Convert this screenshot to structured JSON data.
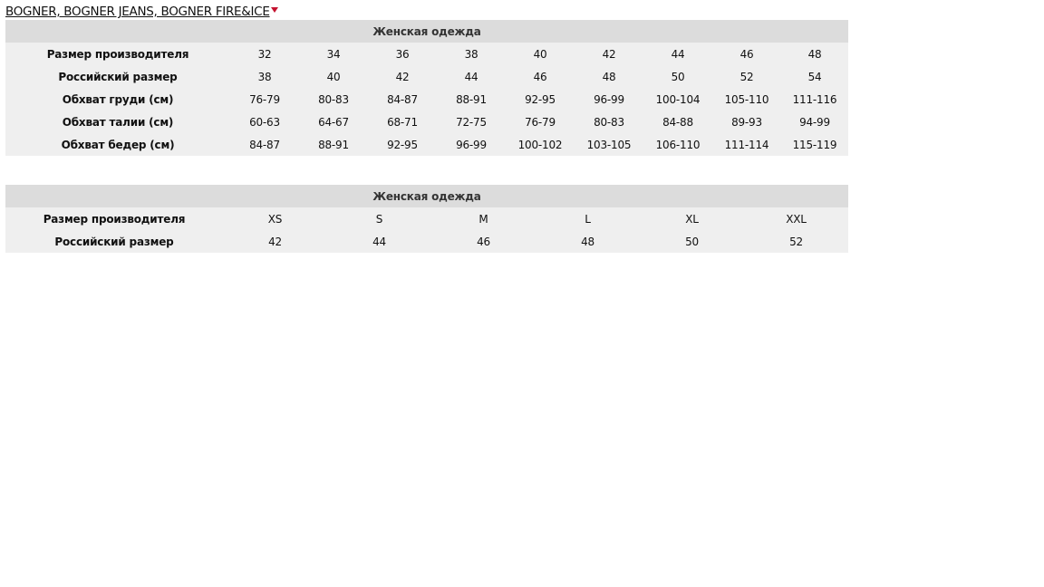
{
  "brand": {
    "label": "BOGNER, BOGNER JEANS, BOGNER FIRE&ICE",
    "arrow_color": "#c4122f"
  },
  "tables": [
    {
      "title": "Женская одежда",
      "rows": [
        {
          "label": "Размер производителя",
          "cells": [
            "32",
            "34",
            "36",
            "38",
            "40",
            "42",
            "44",
            "46",
            "48"
          ]
        },
        {
          "label": "Российский размер",
          "cells": [
            "38",
            "40",
            "42",
            "44",
            "46",
            "48",
            "50",
            "52",
            "54"
          ]
        },
        {
          "label": "Обхват груди (см)",
          "cells": [
            "76-79",
            "80-83",
            "84-87",
            "88-91",
            "92-95",
            "96-99",
            "100-104",
            "105-110",
            "111-116"
          ]
        },
        {
          "label": "Обхват талии (см)",
          "cells": [
            "60-63",
            "64-67",
            "68-71",
            "72-75",
            "76-79",
            "80-83",
            "84-88",
            "89-93",
            "94-99"
          ]
        },
        {
          "label": "Обхват бедер (см)",
          "cells": [
            "84-87",
            "88-91",
            "92-95",
            "96-99",
            "100-102",
            "103-105",
            "106-110",
            "111-114",
            "115-119"
          ]
        }
      ]
    },
    {
      "title": "Женская одежда",
      "rows": [
        {
          "label": "Размер производителя",
          "cells": [
            "XS",
            "S",
            "M",
            "L",
            "XL",
            "XXL"
          ]
        },
        {
          "label": "Российский размер",
          "cells": [
            "42",
            "44",
            "46",
            "48",
            "50",
            "52"
          ]
        }
      ]
    }
  ],
  "colors": {
    "header_bg": "#dcdcdc",
    "row_bg": "#efefef"
  }
}
